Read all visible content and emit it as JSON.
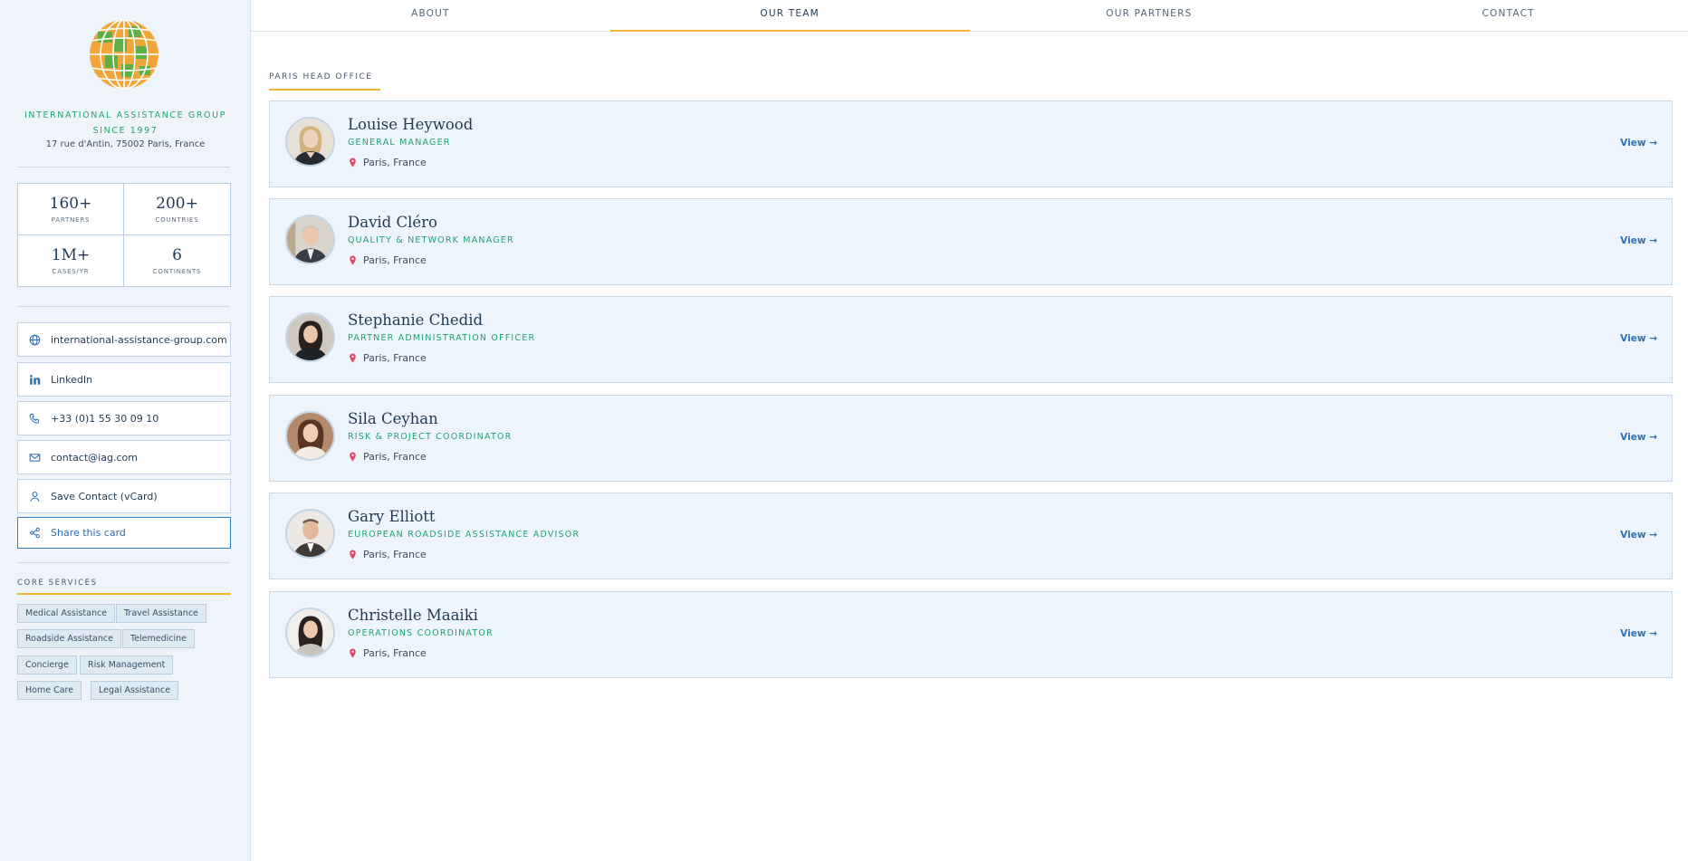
{
  "sidebar": {
    "org_name": "INTERNATIONAL ASSISTANCE GROUP",
    "since": "SINCE 1997",
    "address": "17 rue d'Antin, 75002 Paris, France",
    "stats": [
      {
        "value": "160+",
        "label": "PARTNERS"
      },
      {
        "value": "200+",
        "label": "COUNTRIES"
      },
      {
        "value": "1M+",
        "label": "CASES/YR"
      },
      {
        "value": "6",
        "label": "CONTINENTS"
      }
    ],
    "links": {
      "website": "international-assistance-group.com",
      "linkedin": "LinkedIn",
      "phone": "+33 (0)1 55 30 09 10",
      "email": "contact@iag.com",
      "vcard": "Save Contact (vCard)",
      "share": "Share this card"
    },
    "services_title": "CORE SERVICES",
    "services": [
      "Medical Assistance",
      "Travel Assistance",
      "Roadside Assistance",
      "Telemedicine",
      "Concierge",
      "Risk Management",
      "Home Care",
      "Legal Assistance"
    ]
  },
  "nav": {
    "tabs": [
      "ABOUT",
      "OUR TEAM",
      "OUR PARTNERS",
      "CONTACT"
    ],
    "active": "OUR TEAM"
  },
  "main": {
    "office_title": "PARIS HEAD OFFICE",
    "view_label": "View →",
    "members": [
      {
        "name": "Louise Heywood",
        "role": "GENERAL MANAGER",
        "location": "Paris, France"
      },
      {
        "name": "David Cléro",
        "role": "QUALITY & NETWORK MANAGER",
        "location": "Paris, France"
      },
      {
        "name": "Stephanie Chedid",
        "role": "PARTNER ADMINISTRATION OFFICER",
        "location": "Paris, France"
      },
      {
        "name": "Sila Ceyhan",
        "role": "RISK & PROJECT COORDINATOR",
        "location": "Paris, France"
      },
      {
        "name": "Gary Elliott",
        "role": "EUROPEAN ROADSIDE ASSISTANCE ADVISOR",
        "location": "Paris, France"
      },
      {
        "name": "Christelle Maaiki",
        "role": "OPERATIONS COORDINATOR",
        "location": "Paris, France"
      }
    ]
  },
  "colors": {
    "accent_gold": "#f2b531",
    "brand_green": "#23a46b",
    "link_blue": "#2e6fb0",
    "navy": "#1f3a52"
  }
}
